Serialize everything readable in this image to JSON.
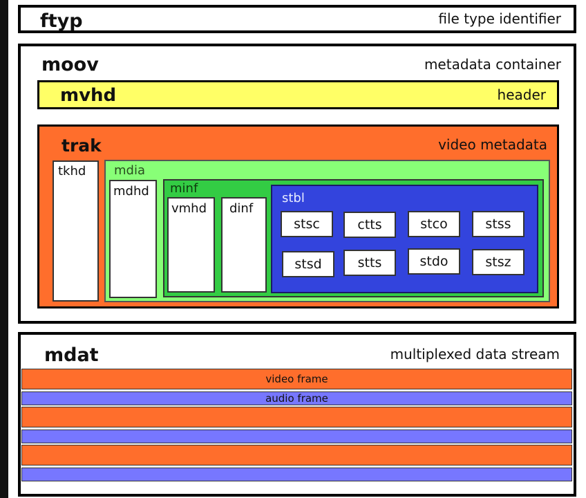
{
  "colors": {
    "outline": "#000000",
    "mvhd_fill": "#ffff66",
    "trak_fill": "#ff6e2c",
    "mdia_fill": "#88ff77",
    "minf_fill": "#33cc44",
    "stbl_fill": "#3344dd",
    "video_frame": "#ff6e2c",
    "audio_frame": "#7777ff"
  },
  "ftyp": {
    "name": "ftyp",
    "description": "file type identifier"
  },
  "moov": {
    "name": "moov",
    "description": "metadata container",
    "mvhd": {
      "name": "mvhd",
      "description": "header"
    },
    "trak": {
      "name": "trak",
      "description": "video metadata",
      "tkhd": "tkhd",
      "mdia": {
        "name": "mdia",
        "mdhd": "mdhd",
        "minf": {
          "name": "minf",
          "vmhd": "vmhd",
          "dinf": "dinf",
          "stbl": {
            "name": "stbl",
            "atoms": [
              "stsc",
              "ctts",
              "stco",
              "stss",
              "stsd",
              "stts",
              "stdo",
              "stsz"
            ]
          }
        }
      }
    }
  },
  "mdat": {
    "name": "mdat",
    "description": "multiplexed data stream",
    "frames": [
      {
        "type": "video",
        "label": "video frame"
      },
      {
        "type": "audio",
        "label": "audio frame"
      },
      {
        "type": "video",
        "label": ""
      },
      {
        "type": "audio",
        "label": ""
      },
      {
        "type": "video",
        "label": ""
      },
      {
        "type": "audio",
        "label": ""
      }
    ]
  }
}
